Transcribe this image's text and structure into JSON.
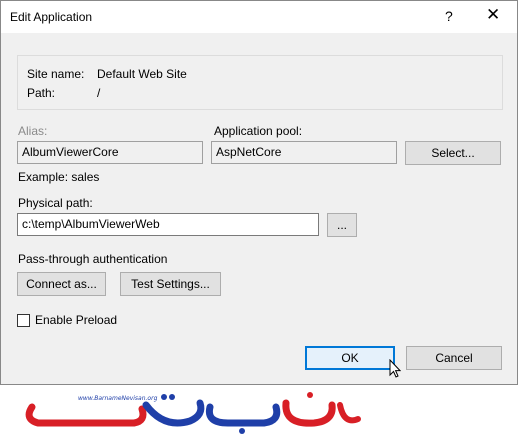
{
  "window": {
    "title": "Edit Application",
    "help_glyph": "?",
    "close_glyph": "✕"
  },
  "info": {
    "site_name_label": "Site name:",
    "site_name_value": "Default Web Site",
    "path_label": "Path:",
    "path_value": "/"
  },
  "alias": {
    "label": "Alias:",
    "value": "AlbumViewerCore",
    "example": "Example: sales"
  },
  "app_pool": {
    "label": "Application pool:",
    "value": "AspNetCore",
    "select_label": "Select..."
  },
  "physical_path": {
    "label": "Physical path:",
    "value": "c:\\temp\\AlbumViewerWeb",
    "browse_label": "..."
  },
  "auth": {
    "label": "Pass-through authentication",
    "connect_label": "Connect as...",
    "test_label": "Test Settings..."
  },
  "preload": {
    "label": "Enable Preload",
    "checked": false
  },
  "footer": {
    "ok_label": "OK",
    "cancel_label": "Cancel"
  },
  "watermark": {
    "url_text": "www.BarnameNevisan.org",
    "logo_text": "برنامه نویسان"
  },
  "colors": {
    "accent": "#0078d7",
    "logo_blue": "#1f3fa8",
    "logo_red": "#d81f26"
  }
}
